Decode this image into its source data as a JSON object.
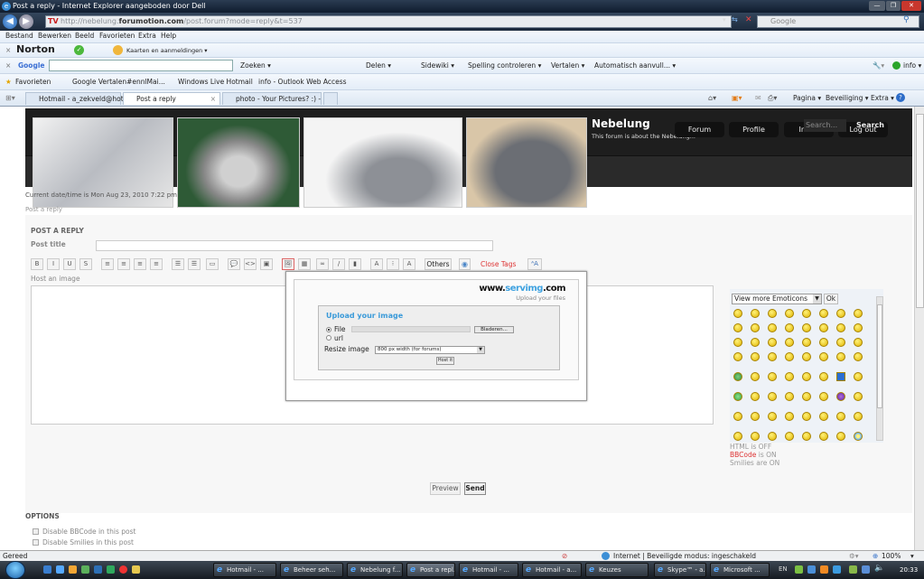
{
  "window": {
    "title": "Post a reply - Internet Explorer aangeboden door Dell",
    "minimize": "—",
    "restore": "❐",
    "close": "✕"
  },
  "address_bar": {
    "url_prefix": "http://nebelung.",
    "url_domain": "forumotion.com",
    "url_suffix": "/post.forum?mode=reply&t=537",
    "site_badge": "TV",
    "search_placeholder": "Google"
  },
  "menu": [
    "Bestand",
    "Bewerken",
    "Beeld",
    "Favorieten",
    "Extra",
    "Help"
  ],
  "norton_bar": {
    "brand": "Norton",
    "item": "Kaarten en aanmeldingen ▾"
  },
  "google_bar": {
    "brand": "Google",
    "items": [
      "Zoeken ▾",
      "Delen ▾",
      "Sidewiki ▾",
      "Spelling controleren ▾",
      "Vertalen ▾",
      "Automatisch aanvull... ▾",
      "info ▾"
    ]
  },
  "favorites_bar": {
    "label": "Favorieten",
    "items": [
      "Google Vertalen#ennlMai...",
      "Windows Live Hotmail",
      "info - Outlook Web Access"
    ]
  },
  "tabs": [
    {
      "label": "Hotmail - a_zekveld@hot...",
      "active": false
    },
    {
      "label": "Post a reply",
      "active": true
    },
    {
      "label": "photo - Your Pictures? :) - ...",
      "active": false
    }
  ],
  "command_bar": [
    "Pagina ▾",
    "Beveiliging ▾",
    "Extra ▾"
  ],
  "forum": {
    "brand": "Nebelung",
    "tagline": "This forum is about the Nebelung...",
    "nav": [
      "Forum",
      "Profile",
      "Inbox",
      "Log out"
    ],
    "search_placeholder": "Search...",
    "search_button": "Search",
    "datetime": "Current date/time is Mon Aug 23, 2010 7:22 pm",
    "breadcrumb": "Post a reply",
    "images": [
      "kitten-grey",
      "cat-green-background",
      "cat-lying",
      "cat-sitting"
    ]
  },
  "form": {
    "title": "POST A REPLY",
    "post_title_label": "Post title",
    "post_title_value": "",
    "toolbar": {
      "buttons": [
        "B",
        "I",
        "U",
        "S",
        "≡",
        "≡",
        "≡",
        "≡",
        "☰",
        "☰",
        "▭",
        "💬",
        "<>",
        "▣",
        "🖼",
        "▦",
        "∞",
        "/",
        "▮",
        "A",
        "⁝",
        "A"
      ],
      "others": "Others",
      "close_tags": "Close Tags",
      "font_size": "ᴬA"
    },
    "host_label": "Host an image",
    "message": "",
    "preview": "Preview",
    "send": "Send"
  },
  "upload_popup": {
    "logo_prefix": "www.",
    "logo_mid": "servimg",
    "logo_suffix": ".com",
    "logo_sub": "Upload your files",
    "title": "Upload your image",
    "file_label": "File",
    "url_label": "url",
    "browse": "Bladeren...",
    "resize_label": "Resize image",
    "resize_value": "800 px width (for forums)",
    "host_button": "Host it",
    "selected_source": "File"
  },
  "emoticons": {
    "select_label": "View more Emoticons",
    "ok": "Ok",
    "count": 64
  },
  "status": {
    "html": "HTML is OFF",
    "bbcode_word": "BBCode",
    "bbcode_rest": " is ON",
    "smilies": "Smilies are ON"
  },
  "options": {
    "title": "OPTIONS",
    "items": [
      {
        "label": "Disable BBCode in this post",
        "checked": false
      },
      {
        "label": "Disable Smilies in this post",
        "checked": false
      }
    ]
  },
  "statusbar": {
    "left": "Gereed",
    "zone": "Internet | Beveiligde modus: ingeschakeld",
    "zoom": "100%"
  },
  "taskbar": {
    "tasks": [
      "Hotmail - ...",
      "Beheer seh...",
      "Nebelung f...",
      "Post a repl...",
      "Hotmail - ...",
      "Hotmail - a...",
      "Keuzes",
      "Skype™ - a...",
      "Microsoft ..."
    ],
    "active_task": 3,
    "lang": "EN",
    "clock": "20:33"
  }
}
